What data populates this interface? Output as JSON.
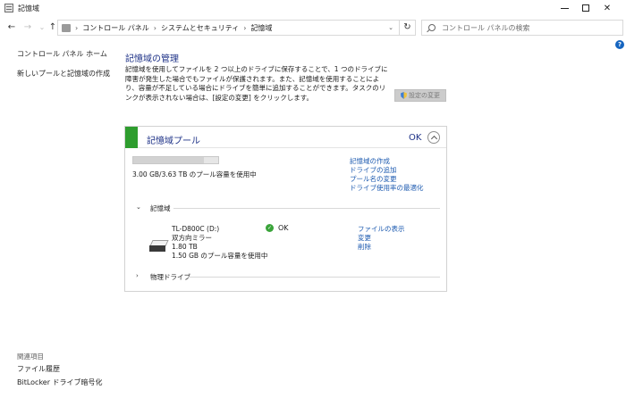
{
  "window": {
    "title": "記憶域",
    "icon": "storage-spaces-icon"
  },
  "nav": {
    "back": "←",
    "forward": "→",
    "recent": "⌄",
    "up": "↑",
    "refresh": "↻"
  },
  "address": {
    "breadcrumbs": [
      "コントロール パネル",
      "システムとセキュリティ",
      "記憶域"
    ]
  },
  "search": {
    "placeholder": "コントロール パネルの検索"
  },
  "help": {
    "label": "?"
  },
  "sidebar": {
    "home": "コントロール パネル ホーム",
    "create_pool": "新しいプールと記憶域の作成",
    "related_heading": "関連項目",
    "related": [
      "ファイル履歴",
      "BitLocker ドライブ暗号化"
    ]
  },
  "main": {
    "title": "記憶域の管理",
    "description": "記憶域を使用してファイルを 2 つ以上のドライブに保存することで、1 つのドライブに障害が発生した場合でもファイルが保護されます。また、記憶域を使用することにより、容量が不足している場合にドライブを簡単に追加することができます。タスクのリンクが表示されない場合は、[設定の変更] をクリックします。",
    "settings_button": "設定の変更"
  },
  "pool": {
    "title": "記憶域プール",
    "status": "OK",
    "accent_color": "#2e9d2e",
    "capacity_fraction": 0.83,
    "capacity_text": "3.00 GB/3.63 TB のプール容量を使用中",
    "links": [
      "記憶域の作成",
      "ドライブの追加",
      "プール名の変更",
      "ドライブ使用率の最適化"
    ],
    "storage_section": "記憶域",
    "physical_section": "物理ドライブ",
    "volume": {
      "name": "TL-D800C (D:)",
      "resiliency": "双方向ミラー",
      "size": "1.80 TB",
      "usage": "1.50 GB のプール容量を使用中",
      "status": "OK",
      "links": [
        "ファイルの表示",
        "変更",
        "削除"
      ]
    }
  }
}
